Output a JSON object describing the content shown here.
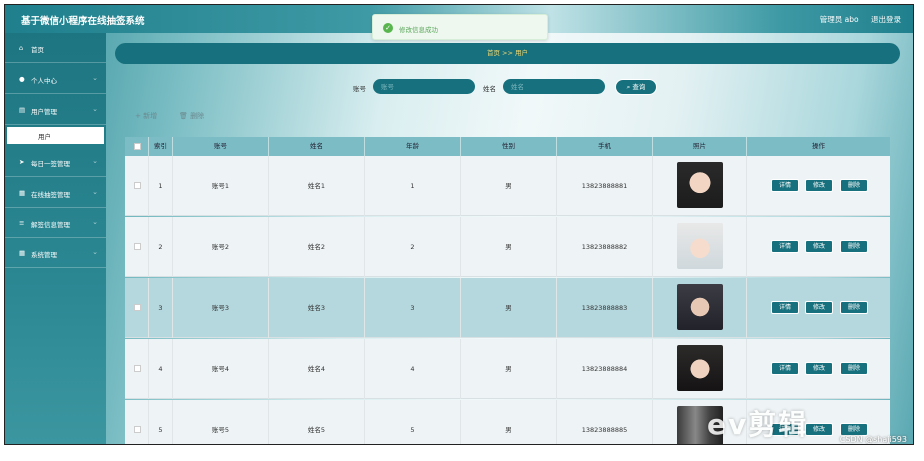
{
  "header": {
    "title": "基于微信小程序在线抽签系统",
    "admin": "管理员 abo",
    "logout": "退出登录"
  },
  "toast": {
    "text": "修改信息成功"
  },
  "sidebar": {
    "items": [
      {
        "label": "首页",
        "icon": "home-icon",
        "glyph": "⌂"
      },
      {
        "label": "个人中心",
        "icon": "user-icon",
        "glyph": "●"
      },
      {
        "label": "用户管理",
        "icon": "folder-icon",
        "glyph": "▤"
      },
      {
        "label": "每日一签管理",
        "icon": "send-icon",
        "glyph": "➤"
      },
      {
        "label": "在线抽签管理",
        "icon": "grid-icon",
        "glyph": "▦"
      },
      {
        "label": "解签信息管理",
        "icon": "list-icon",
        "glyph": "≡"
      },
      {
        "label": "系统管理",
        "icon": "grid-icon",
        "glyph": "▦"
      }
    ],
    "sub_active": "用户"
  },
  "breadcrumb": {
    "home": "首页",
    "sep": ">>",
    "current": "用户"
  },
  "search": {
    "account_label": "账号",
    "account_placeholder": "账号",
    "name_label": "姓名",
    "name_placeholder": "姓名",
    "button": "查询"
  },
  "actions": {
    "add": "+ 新增",
    "delete": "删除"
  },
  "table": {
    "headers": [
      "索引",
      "账号",
      "姓名",
      "年龄",
      "性别",
      "手机",
      "照片",
      "操作"
    ],
    "rows": [
      {
        "idx": "1",
        "account": "账号1",
        "name": "姓名1",
        "age": "1",
        "gender": "男",
        "phone": "13823888881"
      },
      {
        "idx": "2",
        "account": "账号2",
        "name": "姓名2",
        "age": "2",
        "gender": "男",
        "phone": "13823888882"
      },
      {
        "idx": "3",
        "account": "账号3",
        "name": "姓名3",
        "age": "3",
        "gender": "男",
        "phone": "13823888883"
      },
      {
        "idx": "4",
        "account": "账号4",
        "name": "姓名4",
        "age": "4",
        "gender": "男",
        "phone": "13823888884"
      },
      {
        "idx": "5",
        "account": "账号5",
        "name": "姓名5",
        "age": "5",
        "gender": "男",
        "phone": "13823888885"
      }
    ],
    "row_buttons": {
      "detail": "详情",
      "edit": "修改",
      "delete": "删除"
    }
  },
  "watermark": {
    "ev": "ev剪辑",
    "csdn": "CSDN @shaji593"
  },
  "colors": {
    "primary": "#17707d",
    "accent": "#f5d76e",
    "success": "#59b64f"
  }
}
